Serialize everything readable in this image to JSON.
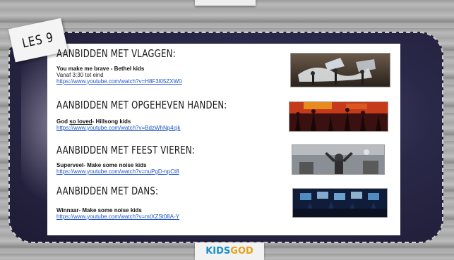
{
  "slide": {
    "les_label": "LES 9",
    "sections": [
      {
        "heading": "AANBIDDEN MET VLAGGEN:",
        "song_bold": "You make me brave - Bethel kids",
        "song_underlined": "",
        "song_rest": "",
        "note": "Vanaf 3:30 tot eind",
        "link": "https://www.youtube.com/watch?v=H8F3l05ZXW0"
      },
      {
        "heading": "AANBIDDEN MET OPGEHEVEN HANDEN:",
        "song_bold": "God ",
        "song_underlined": "so loved",
        "song_rest": "- Hillsong kids",
        "note": "",
        "link": "https://www.youtube.com/watch?v=BdzWhNp4cjk"
      },
      {
        "heading": "AANBIDDEN MET FEEST VIEREN:",
        "song_bold": "Superveel- Make some noise kids",
        "song_underlined": "",
        "song_rest": "",
        "note": "",
        "link": "https://www.youtube.com/watch?v=nuPgD-npCt8"
      },
      {
        "heading": "AANBIDDEN MET DANS:",
        "song_bold": "Winnaar- Make some noise kids",
        "song_underlined": "",
        "song_rest": "",
        "note": "",
        "link": "https://www.youtube.com/watch?v=mtXZSt08A-Y"
      }
    ],
    "logo": {
      "part1": "KIDS",
      "part2": "GOD"
    }
  },
  "colors": {
    "link": "#1f54c7",
    "logo_kids": "#1a8fc6",
    "logo_god": "#e4a21a"
  }
}
